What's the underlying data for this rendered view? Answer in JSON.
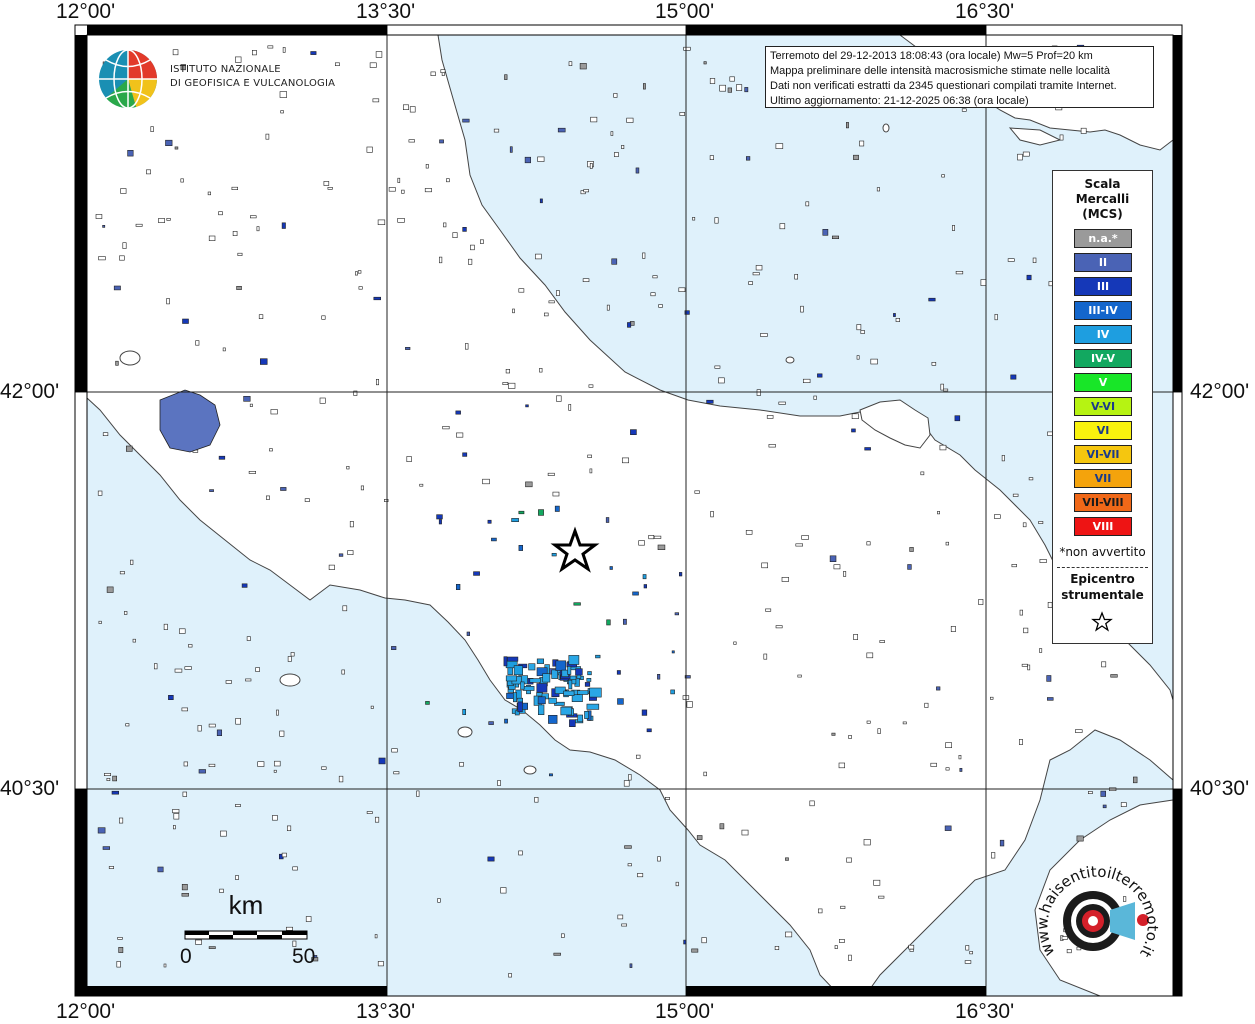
{
  "map": {
    "lon_labels": [
      "12°00'",
      "13°30'",
      "15°00'",
      "16°30'"
    ],
    "lat_labels": [
      "42°00'",
      "40°30'"
    ],
    "colors": {
      "sea": "#dff1fb",
      "land": "#ffffff",
      "frame": "#000000"
    }
  },
  "logo": {
    "line1": "ISTITUTO NAZIONALE",
    "line2": "DI GEOFISICA E VULCANOLOGIA"
  },
  "info": {
    "line1": "Terremoto del 29-12-2013 18:08:43 (ora locale) Mw=5 Prof=20 km",
    "line2": "Mappa preliminare delle intensità macrosismiche stimate nelle località",
    "line3": "Dati non verificati estratti da 2345 questionari compilati tramite Internet.",
    "line4": "Ultimo aggiornamento: 21-12-2025 06:38 (ora locale)"
  },
  "legend": {
    "title_l1": "Scala",
    "title_l2": "Mercalli",
    "title_l3": "(MCS)",
    "items": [
      {
        "label": "n.a.*",
        "color": "#9a9a9a",
        "text_color": "#ffffff"
      },
      {
        "label": "II",
        "color": "#4a63b5",
        "text_color": "#ffffff"
      },
      {
        "label": "III",
        "color": "#1538b8",
        "text_color": "#ffffff"
      },
      {
        "label": "III-IV",
        "color": "#1466cc",
        "text_color": "#ffffff"
      },
      {
        "label": "IV",
        "color": "#1e9ee0",
        "text_color": "#ffffff"
      },
      {
        "label": "IV-V",
        "color": "#12a860",
        "text_color": "#ffffff"
      },
      {
        "label": "V",
        "color": "#18e628",
        "text_color": "#ffffff"
      },
      {
        "label": "V-VI",
        "color": "#b6f312",
        "text_color": "#1a3a8a"
      },
      {
        "label": "VI",
        "color": "#f8f20e",
        "text_color": "#1a3a8a"
      },
      {
        "label": "VI-VII",
        "color": "#f5c60f",
        "text_color": "#1a3a8a"
      },
      {
        "label": "VII",
        "color": "#f4a30c",
        "text_color": "#1a3a8a"
      },
      {
        "label": "VII-VIII",
        "color": "#f06818",
        "text_color": "#1a1a1a"
      },
      {
        "label": "VIII",
        "color": "#ee1414",
        "text_color": "#ffffff"
      }
    ],
    "note": "*non avvertito",
    "epicenter_l1": "Epicentro",
    "epicenter_l2": "strumentale"
  },
  "scalebar": {
    "unit": "km",
    "start": "0",
    "end": "50"
  },
  "brand": {
    "text": "haisentitoilterremoto.it",
    "prefix": "www."
  }
}
